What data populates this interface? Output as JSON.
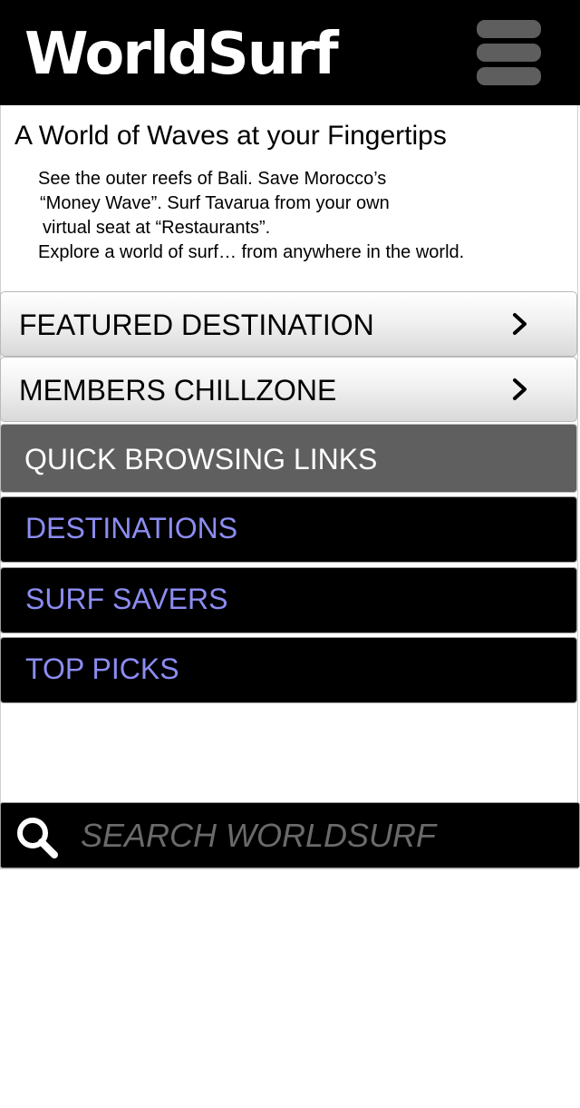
{
  "header": {
    "app_title": "WorldSurf",
    "menu_icon": "hamburger-menu-icon"
  },
  "intro": {
    "tagline": "A World of Waves at your Fingertips",
    "lines": [
      "See the outer reefs of Bali. Save Morocco’s",
      "“Money Wave”. Surf Tavarua from your own",
      "virtual seat at “Restaurants”.",
      "Explore a world of surf… from anywhere in the world."
    ]
  },
  "nav": {
    "items": [
      {
        "label": "FEATURED DESTINATION",
        "icon": "chevron-right-icon"
      },
      {
        "label": "MEMBERS CHILLZONE",
        "icon": "chevron-right-icon"
      }
    ]
  },
  "quick_links": {
    "heading": "QUICK BROWSING LINKS",
    "items": [
      {
        "label": "DESTINATIONS"
      },
      {
        "label": "SURF SAVERS"
      },
      {
        "label": "TOP PICKS"
      }
    ]
  },
  "search": {
    "icon": "search-icon",
    "placeholder": "SEARCH WORLDSURF",
    "value": ""
  },
  "colors": {
    "header_bg": "#000000",
    "section_bg": "#5f5f5f",
    "link_text": "#8c8cf2",
    "menu_bars": "#5e5e5e",
    "search_icon": "#ffffff",
    "placeholder": "#6a6a6a"
  }
}
